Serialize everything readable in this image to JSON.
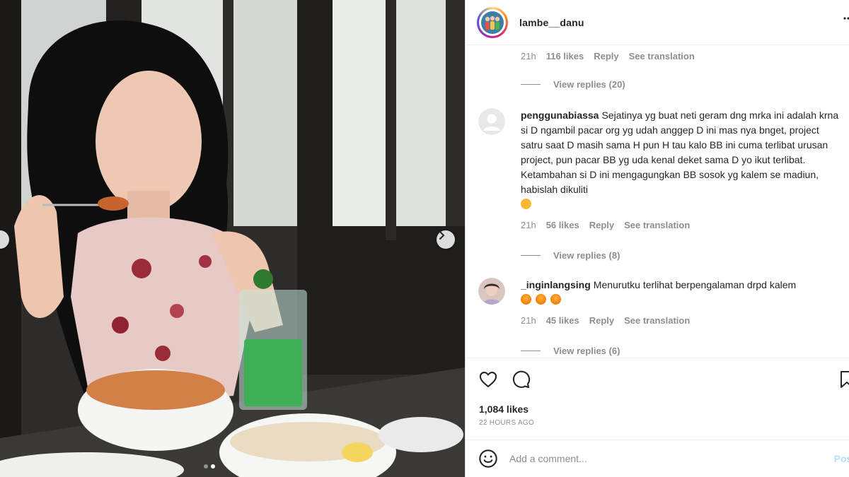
{
  "post": {
    "username": "lambe__danu",
    "likes_text": "1,084 likes",
    "time_ago": "22 HOURS AGO"
  },
  "top_comment_tail": {
    "time": "21h",
    "likes": "116 likes",
    "reply": "Reply",
    "translate": "See translation",
    "view_replies": "View replies (20)"
  },
  "comments": [
    {
      "username": "penggunabiassa",
      "text": "Sejatinya yg buat neti geram dng mrka ini adalah krna si D ngambil pacar org yg udah anggep D ini mas nya bnget, project satru saat D masih sama H pun H tau kalo BB ini cuma terlibat urusan project, pun pacar BB yg uda kenal deket sama D yo ikut terlibat. Ketambahan si D ini mengagungkan BB sosok yg kalem se madiun, habislah dikuliti",
      "emoji": "😂",
      "time": "21h",
      "likes": "56 likes",
      "reply": "Reply",
      "translate": "See translation",
      "view_replies": "View replies (8)"
    },
    {
      "username": "_inginlangsing",
      "text": "Menurutku terlihat berpengalaman drpd kalem",
      "emoji": "🤭🤭🤭",
      "time": "21h",
      "likes": "45 likes",
      "reply": "Reply",
      "translate": "See translation",
      "view_replies": "View replies (6)"
    }
  ],
  "add_comment": {
    "placeholder": "Add a comment...",
    "post_label": "Post"
  },
  "icons": {
    "like": "heart-icon",
    "comment": "comment-icon",
    "save": "bookmark-icon",
    "emoji": "smiley-icon",
    "next": "chevron-right-icon",
    "more": "more-icon"
  },
  "colors": {
    "text": "#262626",
    "muted": "#8e8e8e",
    "post_button": "#b2dffc"
  }
}
